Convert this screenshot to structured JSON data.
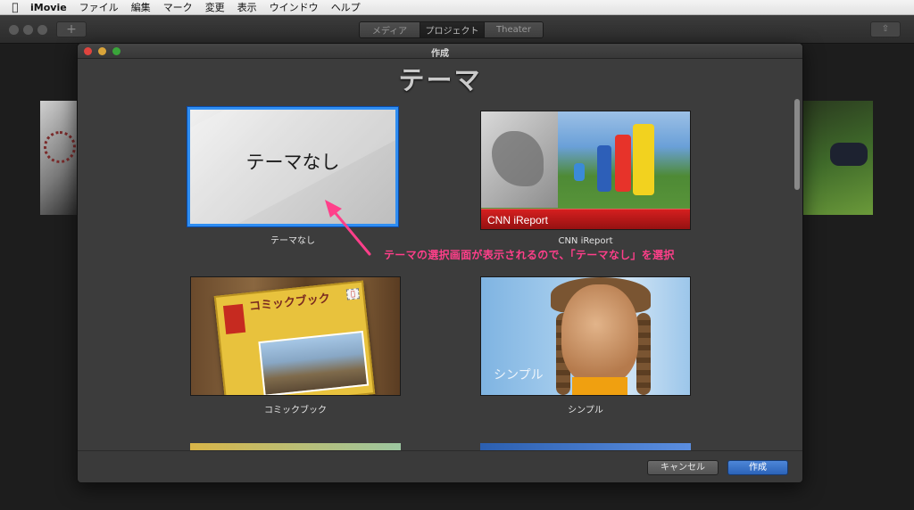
{
  "menubar": {
    "app_name": "iMovie",
    "items": [
      "ファイル",
      "編集",
      "マーク",
      "変更",
      "表示",
      "ウインドウ",
      "ヘルプ"
    ]
  },
  "toolbar": {
    "tabs": [
      {
        "label": "メディア",
        "active": false
      },
      {
        "label": "プロジェクト",
        "active": true
      },
      {
        "label": "Theater",
        "active": false
      }
    ]
  },
  "dialog": {
    "window_title": "作成",
    "heading": "テーマ",
    "themes": [
      {
        "id": "none",
        "label": "テーマなし",
        "thumb_text": "テーマなし",
        "selected": true
      },
      {
        "id": "cnn",
        "label": "CNN iReport",
        "thumb_text": "CNN iReport",
        "selected": false
      },
      {
        "id": "comic",
        "label": "コミックブック",
        "thumb_text": "コミックブック",
        "selected": false
      },
      {
        "id": "simple",
        "label": "シンプル",
        "thumb_text": "シンプル",
        "selected": false
      }
    ],
    "cancel_label": "キャンセル",
    "create_label": "作成"
  },
  "annotation": {
    "text": "テーマの選択画面が表示されるので、「テーマなし」を選択",
    "color": "#ff3f8a"
  },
  "colors": {
    "selection_border": "#2f8ef2",
    "create_button": "#2b63b8",
    "cnn_red": "#c41818"
  }
}
